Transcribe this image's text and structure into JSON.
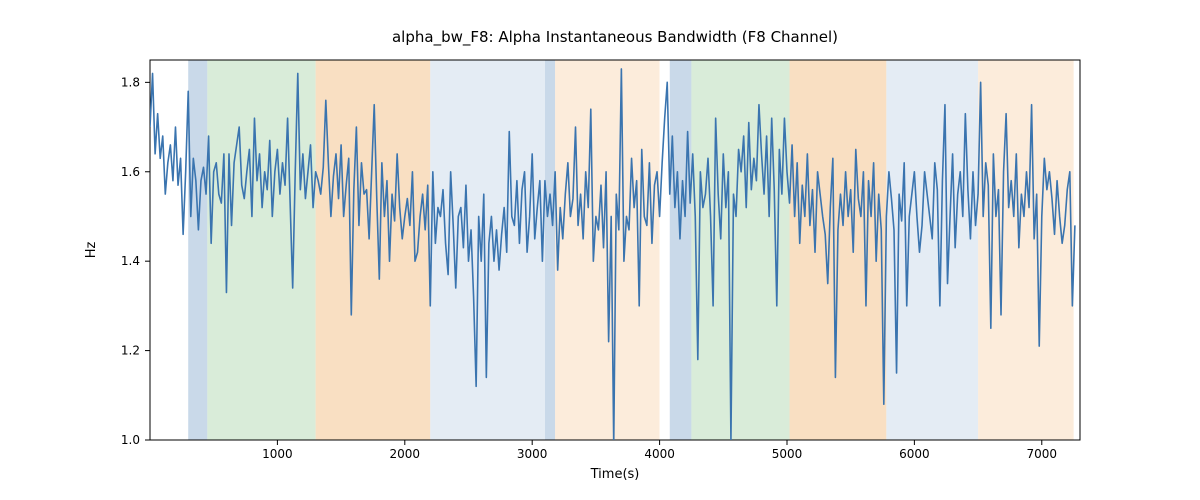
{
  "chart_data": {
    "type": "line",
    "title": "alpha_bw_F8: Alpha Instantaneous Bandwidth (F8 Channel)",
    "xlabel": "Time(s)",
    "ylabel": "Hz",
    "xlim": [
      0,
      7300
    ],
    "ylim": [
      1.0,
      1.85
    ],
    "xticks": [
      1000,
      2000,
      3000,
      4000,
      5000,
      6000,
      7000
    ],
    "yticks": [
      1.0,
      1.2,
      1.4,
      1.6,
      1.8
    ],
    "regions": [
      {
        "x0": 300,
        "x1": 450,
        "color": "#b7cce1"
      },
      {
        "x0": 450,
        "x1": 1300,
        "color": "#cce6cc"
      },
      {
        "x0": 1300,
        "x1": 2200,
        "color": "#f7d4ae"
      },
      {
        "x0": 2200,
        "x1": 3100,
        "color": "#dbe5f0"
      },
      {
        "x0": 3100,
        "x1": 3180,
        "color": "#b7cce1"
      },
      {
        "x0": 3180,
        "x1": 4000,
        "color": "#fbe6cf"
      },
      {
        "x0": 4000,
        "x1": 4080,
        "color": "#ffffff"
      },
      {
        "x0": 4080,
        "x1": 4250,
        "color": "#b7cce1"
      },
      {
        "x0": 4250,
        "x1": 5020,
        "color": "#cce6cc"
      },
      {
        "x0": 5020,
        "x1": 5780,
        "color": "#f7d4ae"
      },
      {
        "x0": 5780,
        "x1": 6500,
        "color": "#dbe5f0"
      },
      {
        "x0": 6500,
        "x1": 7250,
        "color": "#fbe6cf"
      }
    ],
    "line_color": "#3a74af",
    "series": [
      {
        "name": "alpha_bw_F8",
        "x_step": 20,
        "values": [
          1.7,
          1.82,
          1.64,
          1.73,
          1.63,
          1.68,
          1.55,
          1.62,
          1.66,
          1.58,
          1.7,
          1.57,
          1.63,
          1.46,
          1.6,
          1.78,
          1.5,
          1.63,
          1.58,
          1.47,
          1.58,
          1.61,
          1.55,
          1.68,
          1.44,
          1.6,
          1.62,
          1.55,
          1.53,
          1.64,
          1.33,
          1.64,
          1.48,
          1.62,
          1.66,
          1.7,
          1.57,
          1.54,
          1.6,
          1.65,
          1.5,
          1.72,
          1.58,
          1.64,
          1.52,
          1.6,
          1.56,
          1.67,
          1.5,
          1.6,
          1.65,
          1.55,
          1.62,
          1.57,
          1.72,
          1.53,
          1.34,
          1.6,
          1.82,
          1.56,
          1.64,
          1.54,
          1.6,
          1.66,
          1.52,
          1.6,
          1.58,
          1.55,
          1.61,
          1.76,
          1.62,
          1.5,
          1.59,
          1.64,
          1.54,
          1.66,
          1.5,
          1.57,
          1.63,
          1.28,
          1.56,
          1.7,
          1.48,
          1.62,
          1.55,
          1.56,
          1.45,
          1.6,
          1.75,
          1.54,
          1.36,
          1.62,
          1.5,
          1.58,
          1.4,
          1.55,
          1.49,
          1.64,
          1.52,
          1.45,
          1.5,
          1.54,
          1.48,
          1.6,
          1.4,
          1.42,
          1.5,
          1.55,
          1.47,
          1.57,
          1.3,
          1.6,
          1.44,
          1.52,
          1.5,
          1.56,
          1.44,
          1.37,
          1.6,
          1.48,
          1.34,
          1.5,
          1.52,
          1.43,
          1.57,
          1.4,
          1.47,
          1.32,
          1.12,
          1.5,
          1.4,
          1.55,
          1.14,
          1.44,
          1.5,
          1.4,
          1.47,
          1.38,
          1.46,
          1.52,
          1.42,
          1.69,
          1.5,
          1.48,
          1.58,
          1.44,
          1.56,
          1.6,
          1.42,
          1.5,
          1.64,
          1.45,
          1.52,
          1.58,
          1.4,
          1.58,
          1.5,
          1.55,
          1.48,
          1.6,
          1.38,
          1.52,
          1.45,
          1.55,
          1.62,
          1.5,
          1.54,
          1.7,
          1.48,
          1.55,
          1.45,
          1.6,
          1.52,
          1.74,
          1.4,
          1.5,
          1.47,
          1.57,
          1.43,
          1.6,
          1.22,
          1.5,
          0.99,
          1.55,
          1.47,
          1.83,
          1.4,
          1.5,
          1.47,
          1.63,
          1.52,
          1.58,
          1.3,
          1.65,
          1.5,
          1.48,
          1.62,
          1.44,
          1.57,
          1.6,
          1.5,
          1.62,
          1.72,
          1.8,
          1.55,
          1.68,
          1.52,
          1.6,
          1.45,
          1.58,
          1.5,
          1.69,
          1.53,
          1.64,
          1.5,
          1.18,
          1.6,
          1.52,
          1.55,
          1.63,
          1.5,
          1.3,
          1.72,
          1.55,
          1.45,
          1.64,
          1.52,
          1.6,
          1.0,
          1.55,
          1.5,
          1.65,
          1.6,
          1.68,
          1.52,
          1.71,
          1.56,
          1.63,
          1.58,
          1.75,
          1.64,
          1.55,
          1.68,
          1.5,
          1.72,
          1.56,
          1.3,
          1.65,
          1.55,
          1.72,
          1.6,
          1.53,
          1.66,
          1.5,
          1.62,
          1.44,
          1.57,
          1.5,
          1.64,
          1.48,
          1.56,
          1.42,
          1.6,
          1.55,
          1.5,
          1.46,
          1.35,
          1.52,
          1.63,
          1.14,
          1.47,
          1.55,
          1.48,
          1.6,
          1.5,
          1.56,
          1.42,
          1.65,
          1.54,
          1.5,
          1.6,
          1.3,
          1.58,
          1.5,
          1.62,
          1.4,
          1.55,
          1.47,
          1.08,
          1.5,
          1.6,
          1.54,
          1.47,
          1.15,
          1.55,
          1.49,
          1.62,
          1.3,
          1.5,
          1.55,
          1.6,
          1.5,
          1.42,
          1.48,
          1.6,
          1.55,
          1.5,
          1.45,
          1.62,
          1.56,
          1.3,
          1.58,
          1.75,
          1.35,
          1.5,
          1.64,
          1.43,
          1.55,
          1.6,
          1.5,
          1.73,
          1.56,
          1.45,
          1.6,
          1.48,
          1.55,
          1.8,
          1.5,
          1.62,
          1.57,
          1.25,
          1.64,
          1.5,
          1.56,
          1.28,
          1.6,
          1.73,
          1.52,
          1.58,
          1.5,
          1.64,
          1.43,
          1.55,
          1.5,
          1.6,
          1.52,
          1.75,
          1.45,
          1.55,
          1.21,
          1.5,
          1.63,
          1.56,
          1.6,
          1.54,
          1.46,
          1.58,
          1.5,
          1.44,
          1.48,
          1.56,
          1.6,
          1.3,
          1.48
        ]
      }
    ]
  }
}
